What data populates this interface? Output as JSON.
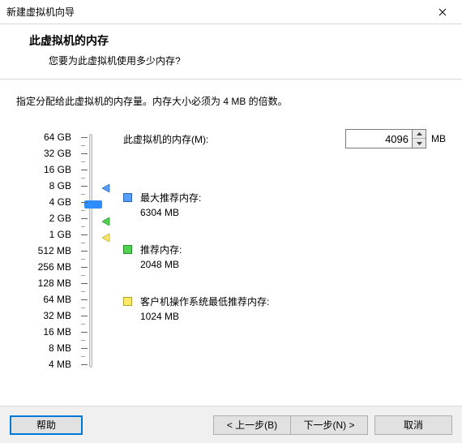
{
  "window": {
    "title": "新建虚拟机向导"
  },
  "header": {
    "title": "此虚拟机的内存",
    "subtitle": "您要为此虚拟机使用多少内存?"
  },
  "instruction": "指定分配给此虚拟机的内存量。内存大小必须为 4 MB 的倍数。",
  "field": {
    "label": "此虚拟机的内存(M):",
    "value": "4096",
    "unit": "MB"
  },
  "scale": [
    "64 GB",
    "32 GB",
    "16 GB",
    "8 GB",
    "4 GB",
    "2 GB",
    "1 GB",
    "512 MB",
    "256 MB",
    "128 MB",
    "64 MB",
    "32 MB",
    "16 MB",
    "8 MB",
    "4 MB"
  ],
  "legend": {
    "max": {
      "label": "最大推荐内存:",
      "value": "6304 MB"
    },
    "rec": {
      "label": "推荐内存:",
      "value": "2048 MB"
    },
    "min": {
      "label": "客户机操作系统最低推荐内存:",
      "value": "1024 MB"
    }
  },
  "buttons": {
    "help": "帮助",
    "back": "< 上一步(B)",
    "next": "下一步(N) >",
    "cancel": "取消"
  }
}
